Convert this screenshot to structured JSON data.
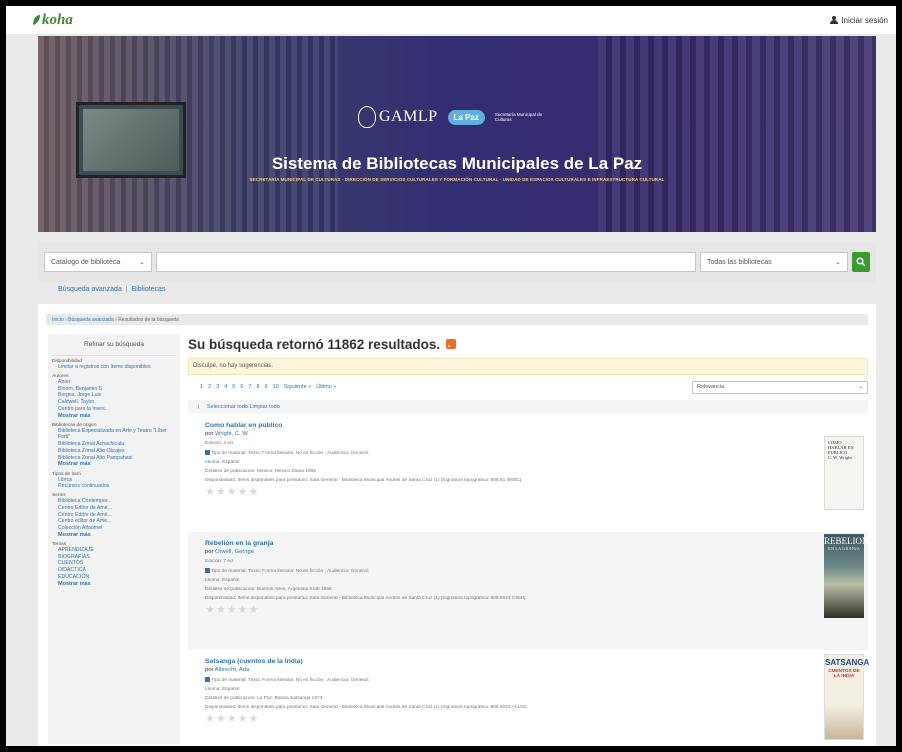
{
  "header": {
    "logo": "koha",
    "login": "Iniciar sesión"
  },
  "banner": {
    "title": "Sistema de Bibliotecas Municipales de La Paz",
    "subtitle": "SECRETARÍA MUNICIPAL DE CULTURAS - DIRECCIÓN DE SERVICIOS CULTURALES Y FORMACIÓN CULTURAL - UNIDAD DE ESPACIOS CULTURALES E INFRAESTRUCTURA CULTURAL",
    "gamlp": "GAMLP",
    "lapaz": "La Paz",
    "secretaria": "Secretaría Municipal de Culturas"
  },
  "search": {
    "catalog": "Catálogo de biblioteca",
    "branches": "Todas las bibliotecas",
    "query": ""
  },
  "links": {
    "advanced": "Búsqueda avanzada",
    "libraries": "Bibliotecas"
  },
  "breadcrumb": {
    "home": "Inicio",
    "advanced": "Búsqueda avanzada",
    "current": "Resultados de la búsqueda"
  },
  "sidebar": {
    "title": "Refinar su búsqueda",
    "availability_title": "Disponibilidad",
    "availability_item": "Limitar a registros con ítems disponibles",
    "authors_title": "Autores",
    "authors": [
      "Anon",
      "Bloom, Benjamin S",
      "Borges, Jorge Luis",
      "Caldwell, Taylor",
      "Centro para la Inves..."
    ],
    "home_title": "Bibliotecas de origen",
    "home": [
      "Biblioteca Especializada en Arte y Teatro \"Líber Forti\"",
      "Biblioteca Zonal Achachicala",
      "Biblioteca Zonal Alto Obrajes",
      "Biblioteca Zonal Alto Pampahasi"
    ],
    "types_title": "Tipos de ítem",
    "types": [
      "Libros",
      "Recursos continuados"
    ],
    "series_title": "Series",
    "series": [
      "Biblioteca Contempor...",
      "Centro Editor de Amé...",
      "Centro Editor de Amé...",
      "Centro editor de Amé...",
      "Colección Alfaomel"
    ],
    "topics_title": "Temas",
    "topics": [
      "APRENDIZAJE",
      "BIOGRAFÍAS",
      "CUENTOS",
      "DIDÁCTICA",
      "EDUCACIÓN"
    ],
    "more": "Mostrar más"
  },
  "results": {
    "title": "Su búsqueda retornó 11862 resultados.",
    "alert": "Disculpe, no hay sugerencias.",
    "pages": [
      "1",
      "2",
      "3",
      "4",
      "5",
      "6",
      "7",
      "8",
      "9",
      "10"
    ],
    "next": "Siguiente »",
    "last": "Último »",
    "sort": "Relevancia",
    "select_all": "Seleccionar todo",
    "clear_all": "Limpiar todo"
  },
  "records": [
    {
      "title": "Como hablar en público",
      "by": "por",
      "author": "Wright, C. W",
      "edition": "Edición: 4 ed",
      "material": "Tipo de material: Texto; Forma literaria: No es ficción ; Audiencia: General;",
      "language": "Idioma: Español",
      "publication": "Detalles de publicación: Mexico, Mexico Diana 1965",
      "availability": "Disponibilidad: Ítems disponibles para préstamo: Sala General - Biblioteca Municipal Andrés de Santa Cruz (1) [Signatura topográfica: 808.51 W93C].",
      "cover_title": "COMO HABLAR EN PUBLICO",
      "cover_sub": "C. W. Wright"
    },
    {
      "title": "Rebelión en la granja",
      "by": "por",
      "author": "Orwell, George",
      "edition": "Edición: 7 ed",
      "material": "Tipo de material: Texto; Forma literaria: No es ficción ; Audiencia: General;",
      "language": "Idioma: Español",
      "publication": "Detalles de publicación: Buenos Aires, Argentina Kraft 1956",
      "availability": "Disponibilidad: Ítems disponibles para préstamo: Sala General - Biblioteca Municipal Andrés de Santa Cruz (1) [Signatura topográfica: 808.8023 Or64r].",
      "cover_title": "REBELION",
      "cover_sub": "EN LA GRANJA"
    },
    {
      "title": "Satsanga (cuentos de la India)",
      "by": "por",
      "author": "Albrecht, Ada",
      "edition": "",
      "material": "Tipo de material: Texto; Forma literaria: No es ficción ; Audiencia: General;",
      "language": "Idioma: Español",
      "publication": "Detalles de publicación: La Paz, Bolivia Satsanga 1973",
      "availability": "Disponibilidad: Ítems disponibles para préstamo: Sala General - Biblioteca Municipal Andrés de Santa Cruz (1) [Signatura topográfica: 808.8023 AL15s].",
      "cover_title": "SATSANGA",
      "cover_sub": "CUENTOS DE LA INDIA"
    }
  ],
  "colors": {
    "brand_green": "#3c9b30",
    "link_blue": "#2f73b3",
    "rss_orange": "#ee6b2b"
  }
}
